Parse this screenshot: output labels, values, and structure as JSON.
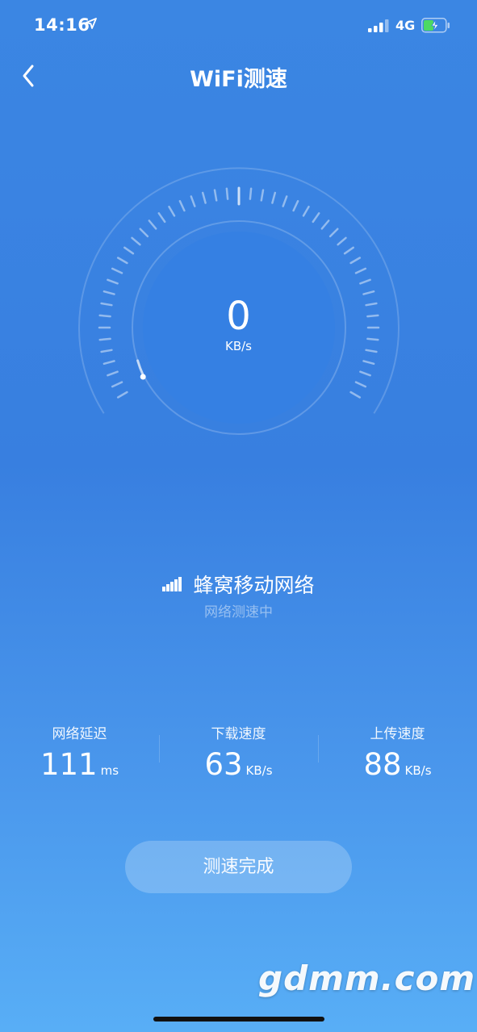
{
  "status_bar": {
    "time": "14:16",
    "network": "4G"
  },
  "header": {
    "title": "WiFi测速"
  },
  "gauge": {
    "speed_value": "0",
    "speed_unit": "KB/s",
    "level": 0
  },
  "network": {
    "name": "蜂窝移动网络",
    "status": "网络测速中"
  },
  "stats": [
    {
      "label": "网络延迟",
      "value": "111",
      "unit": "ms"
    },
    {
      "label": "下载速度",
      "value": "63",
      "unit": "KB/s"
    },
    {
      "label": "上传速度",
      "value": "88",
      "unit": "KB/s"
    }
  ],
  "actions": {
    "done_label": "测速完成"
  },
  "watermark": "gdmm.com",
  "icons": {
    "back": "chevron-left-icon",
    "location": "location-arrow-icon",
    "signal": "cellular-signal-icon",
    "battery": "battery-charging-icon",
    "network": "signal-bars-icon"
  },
  "colors": {
    "background_top": "#3b86e3",
    "background_bottom": "#58aef6",
    "battery_fill": "#4cd964"
  }
}
